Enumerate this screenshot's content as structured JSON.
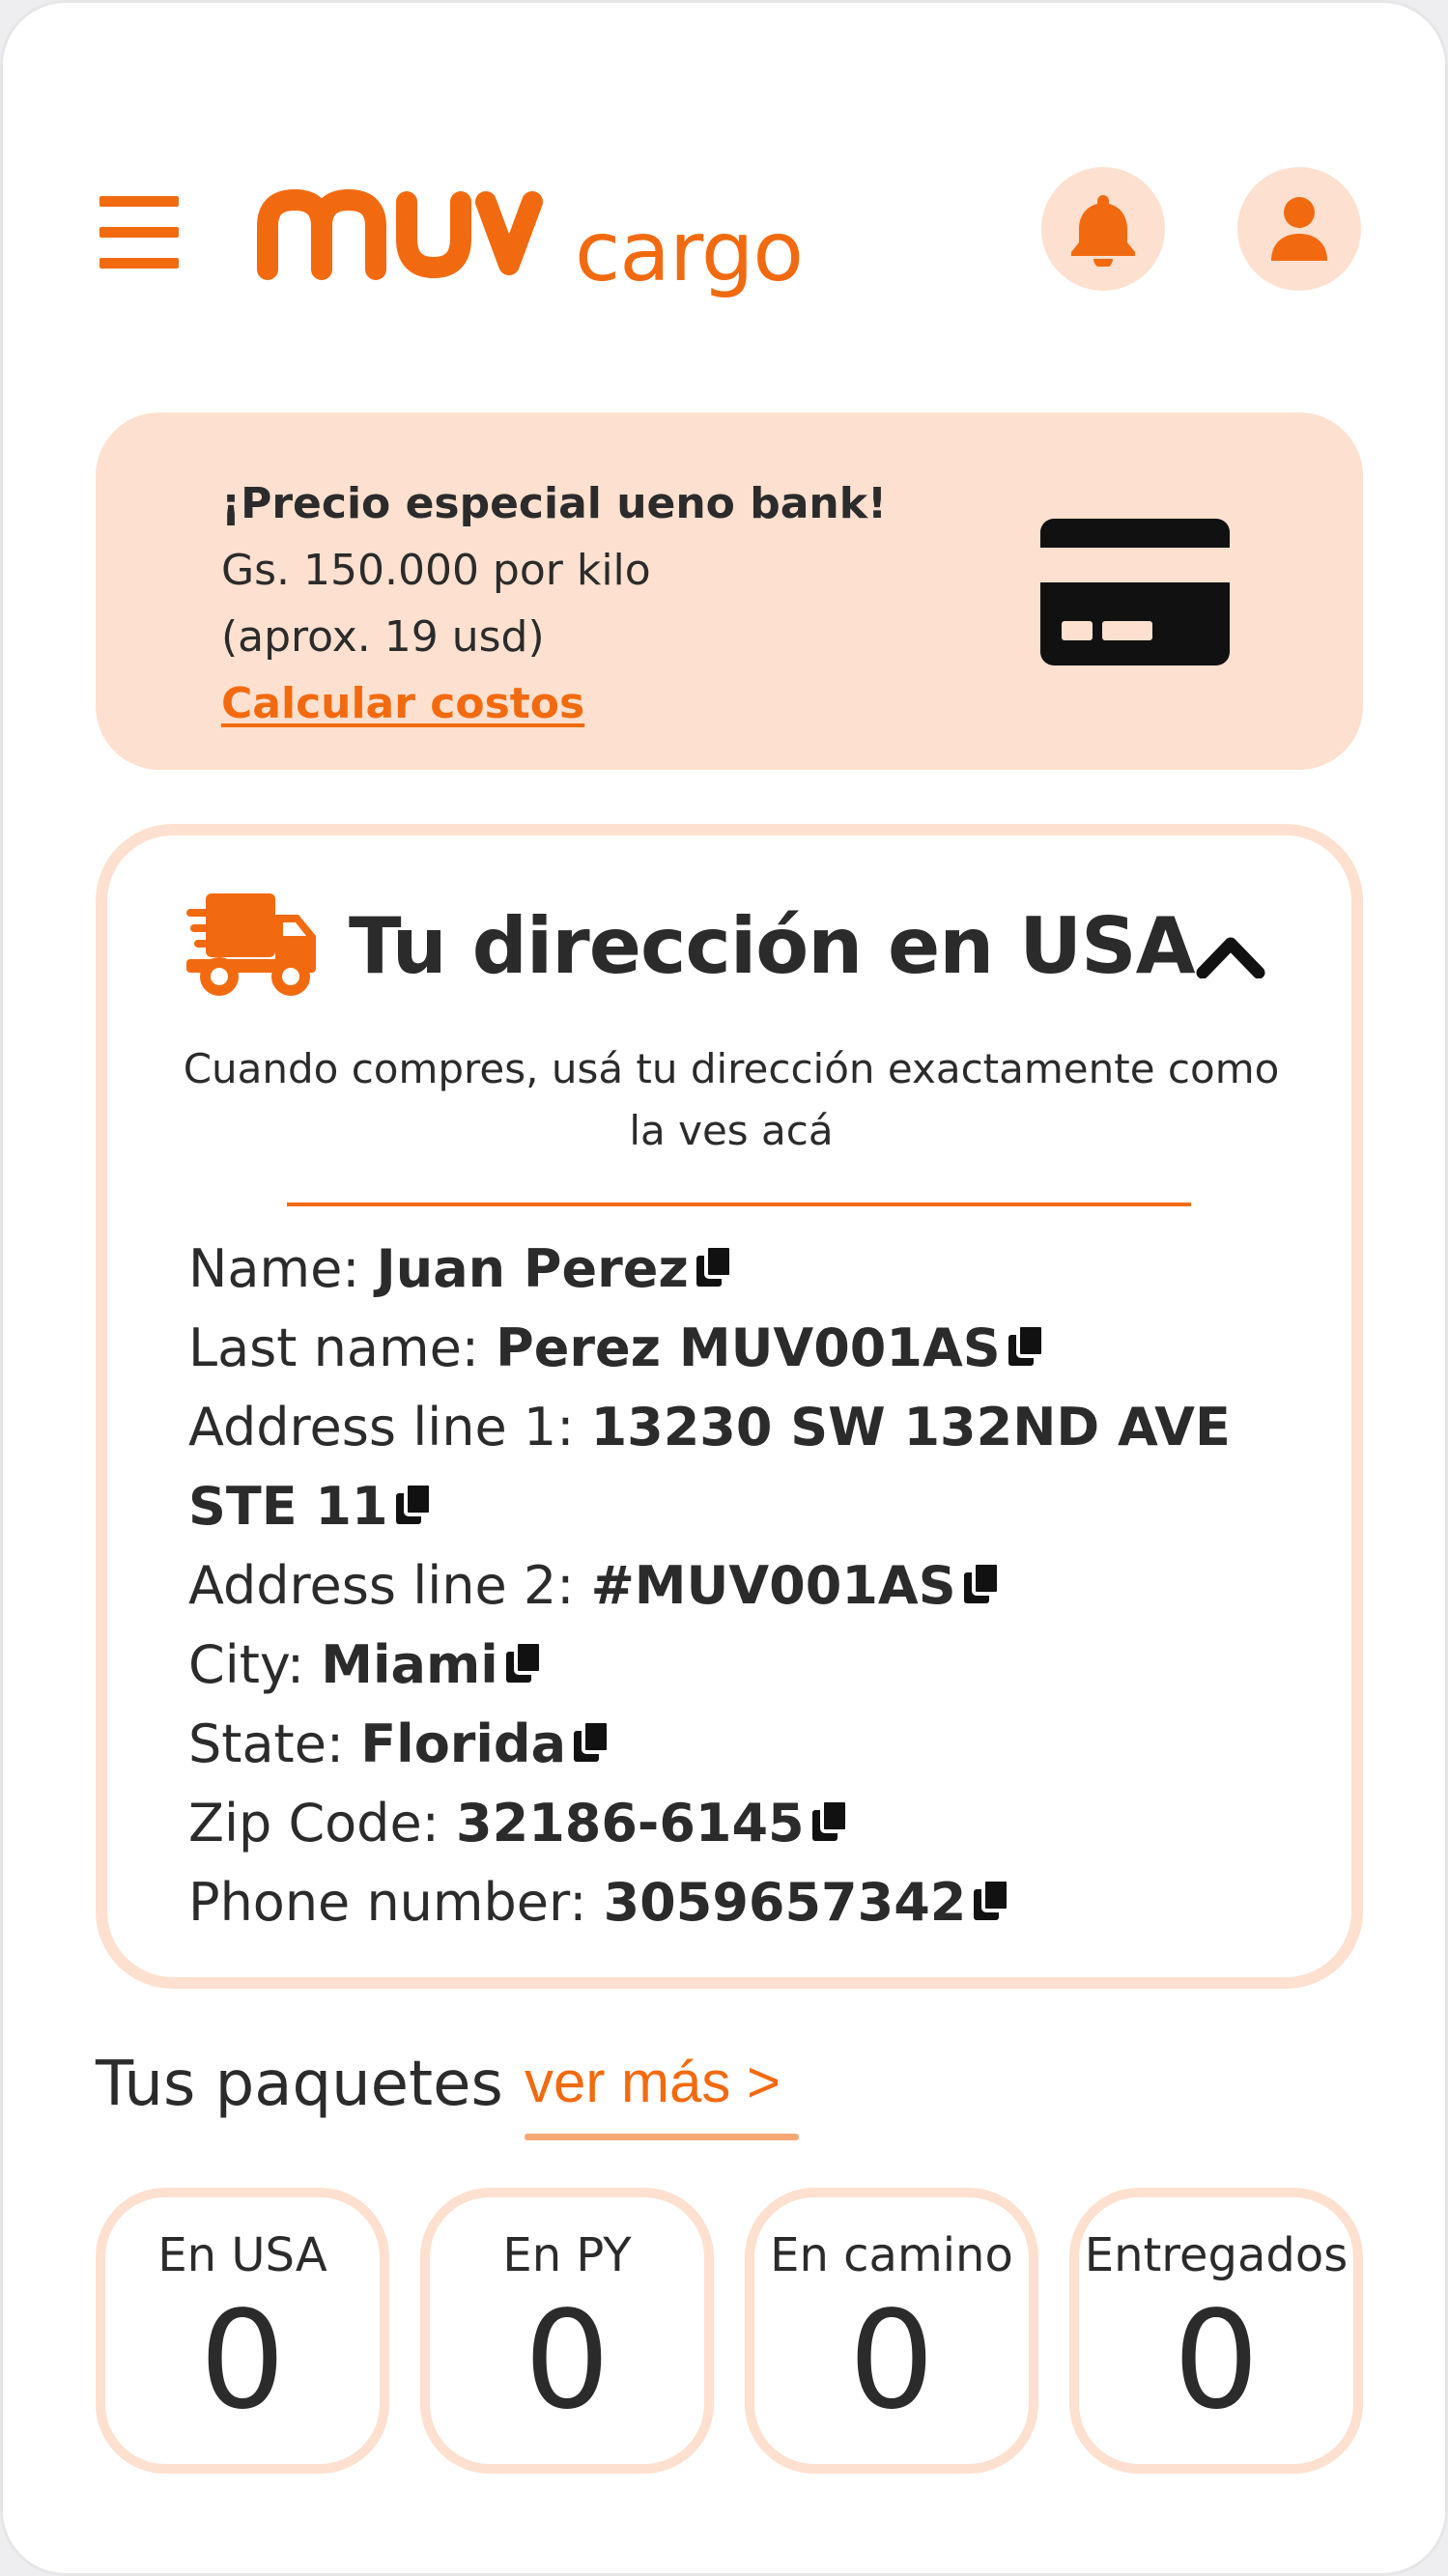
{
  "header": {
    "logo_main": "muv",
    "logo_sub": "cargo",
    "menu_icon": "hamburger-icon",
    "notifications_icon": "bell-icon",
    "profile_icon": "user-icon"
  },
  "promo": {
    "title": "¡Precio especial ueno bank!",
    "line1": "Gs. 150.000 por kilo",
    "line2": "(aprox. 19 usd)",
    "link": "Calcular costos",
    "icon": "credit-card-icon"
  },
  "address": {
    "title": "Tu dirección en USA",
    "subtitle": "Cuando compres, usá tu dirección exactamente como la ves acá",
    "fields": [
      {
        "label": "Name: ",
        "value": "Juan Perez"
      },
      {
        "label": "Last name: ",
        "value": "Perez MUV001AS"
      },
      {
        "label": "Address line 1: ",
        "value": "13230 SW 132ND AVE STE 11"
      },
      {
        "label": "Address line 2: ",
        "value": "#MUV001AS"
      },
      {
        "label": "City: ",
        "value": "Miami"
      },
      {
        "label": "State: ",
        "value": "Florida"
      },
      {
        "label": "Zip Code: ",
        "value": "32186-6145"
      },
      {
        "label": "Phone number: ",
        "value": "3059657342"
      }
    ]
  },
  "packages": {
    "label": "Tus paquetes",
    "see_more": "ver más >",
    "stats": [
      {
        "label": "En USA",
        "value": "0"
      },
      {
        "label": "En PY",
        "value": "0"
      },
      {
        "label": "En camino",
        "value": "0"
      },
      {
        "label": "Entregados",
        "value": "0"
      }
    ]
  },
  "colors": {
    "accent": "#f26a10",
    "soft_accent": "#fde0cf",
    "text": "#2b2b2b"
  }
}
